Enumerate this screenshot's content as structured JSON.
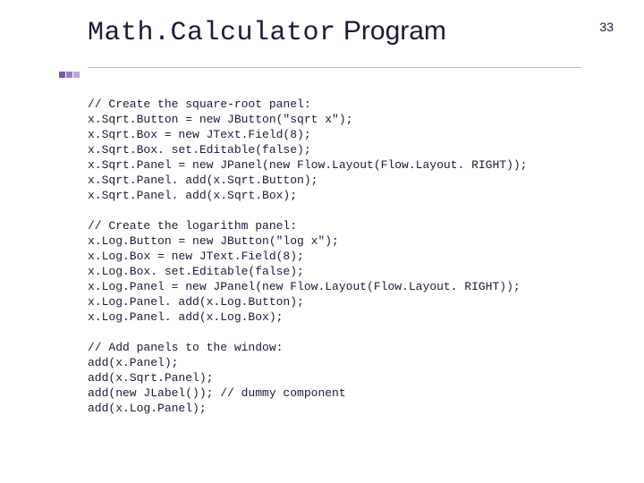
{
  "page_number": "33",
  "title": {
    "mono": "Math.Calculator",
    "sans": " Program"
  },
  "code": {
    "block1": [
      "// Create the square-root panel:",
      "x.Sqrt.Button = new JButton(\"sqrt x\");",
      "x.Sqrt.Box = new JText.Field(8);",
      "x.Sqrt.Box. set.Editable(false);",
      "x.Sqrt.Panel = new JPanel(new Flow.Layout(Flow.Layout. RIGHT));",
      "x.Sqrt.Panel. add(x.Sqrt.Button);",
      "x.Sqrt.Panel. add(x.Sqrt.Box);"
    ],
    "block2": [
      "// Create the logarithm panel:",
      "x.Log.Button = new JButton(\"log x\");",
      "x.Log.Box = new JText.Field(8);",
      "x.Log.Box. set.Editable(false);",
      "x.Log.Panel = new JPanel(new Flow.Layout(Flow.Layout. RIGHT));",
      "x.Log.Panel. add(x.Log.Button);",
      "x.Log.Panel. add(x.Log.Box);"
    ],
    "block3": [
      "// Add panels to the window:",
      "add(x.Panel);",
      "add(x.Sqrt.Panel);",
      "add(new JLabel()); // dummy component",
      "add(x.Log.Panel);"
    ]
  }
}
